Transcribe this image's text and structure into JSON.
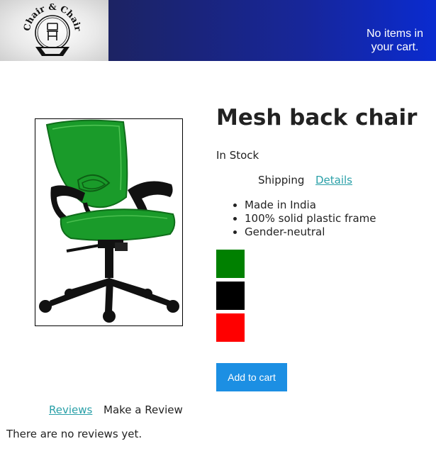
{
  "header": {
    "logo_text": "Chair & Chair",
    "logo_icon": "chair-icon",
    "cart_message": "No items in your cart."
  },
  "product": {
    "image_icon": "office-chair-image",
    "title": "Mesh back chair",
    "stock_status": "In Stock",
    "tabs": {
      "shipping": "Shipping",
      "details": "Details"
    },
    "features": [
      "Made in India",
      "100% solid plastic frame",
      "Gender-neutral"
    ],
    "color_options": [
      {
        "name": "green",
        "hex": "#008000"
      },
      {
        "name": "black",
        "hex": "#000000"
      },
      {
        "name": "red",
        "hex": "#ff0000"
      }
    ],
    "add_to_cart_label": "Add to cart"
  },
  "reviews": {
    "tabs": {
      "reviews": "Reviews",
      "make_review": "Make a Review"
    },
    "empty_message": "There are no reviews yet."
  },
  "colors": {
    "header_gradient_start": "#1c2363",
    "header_gradient_end": "#0a2bd0",
    "link": "#2aa0a8",
    "button": "#1c8fe3"
  }
}
